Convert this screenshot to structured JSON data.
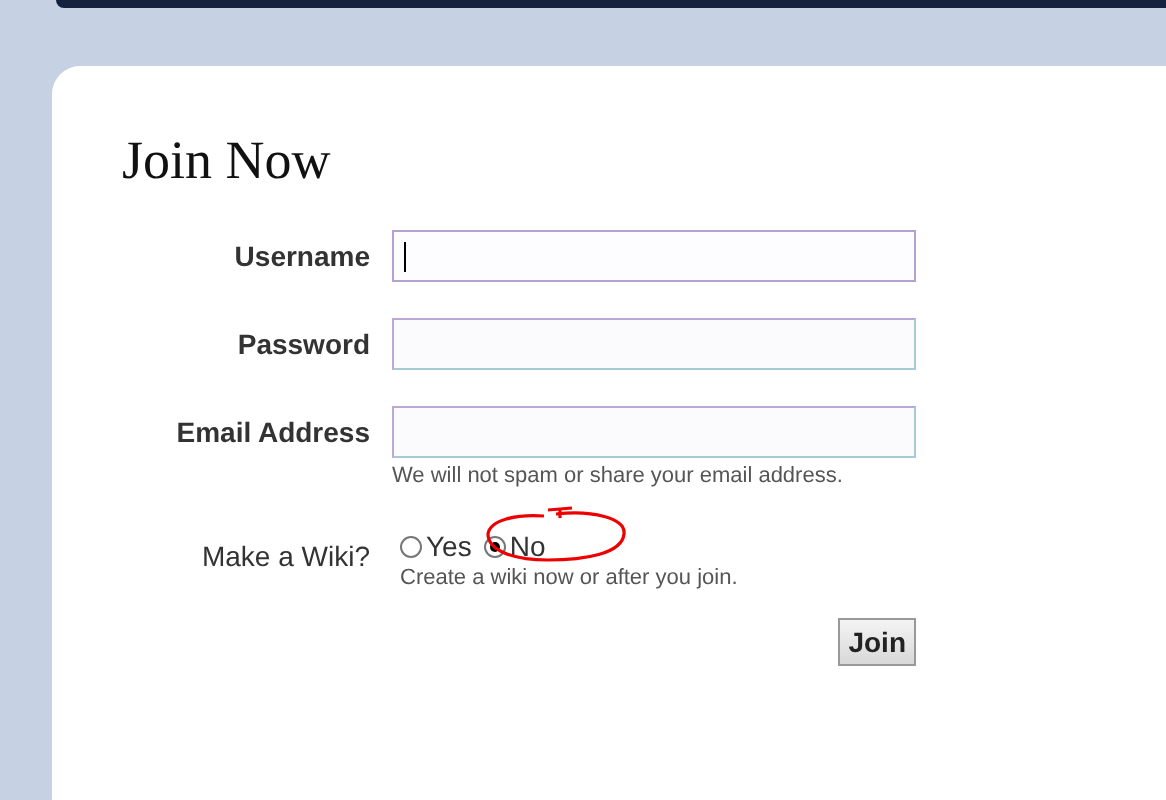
{
  "heading": "Join Now",
  "fields": [
    {
      "label": "Username",
      "focused": true
    },
    {
      "label": "Password",
      "focused": false
    },
    {
      "label": "Email Address",
      "focused": false,
      "hint": "We will not spam or share your email address."
    }
  ],
  "wiki": {
    "label": "Make a Wiki?",
    "options": [
      {
        "label": "Yes",
        "selected": false
      },
      {
        "label": "No",
        "selected": true
      }
    ],
    "hint": "Create a wiki now or after you join."
  },
  "submit": "Join"
}
